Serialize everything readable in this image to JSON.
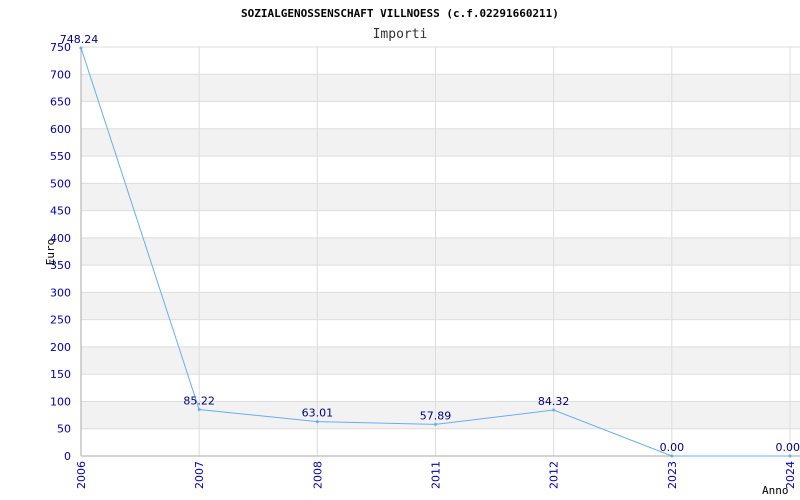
{
  "chart_data": {
    "type": "line",
    "title": "SOZIALGENOSSENSCHAFT VILLNOESS (c.f.02291660211)",
    "subtitle": "Importi",
    "xlabel": "Anno",
    "ylabel": "Euro",
    "categories": [
      "2006",
      "2007",
      "2008",
      "2011",
      "2012",
      "2023",
      "2024"
    ],
    "series": [
      {
        "values": [
          748.24,
          85.22,
          63.01,
          57.89,
          84.32,
          0.0,
          0.0
        ]
      }
    ],
    "data_labels": [
      "748.24",
      "85.22",
      "63.01",
      "57.89",
      "84.32",
      "0.00",
      "0.00"
    ],
    "yticks": [
      0,
      50,
      100,
      150,
      200,
      250,
      300,
      350,
      400,
      450,
      500,
      550,
      600,
      650,
      700,
      750
    ],
    "ylim": [
      0,
      750
    ],
    "grid": true,
    "colors": {
      "line": "#6aaef0",
      "tick_text": "#0000aa",
      "label_text": "#000080",
      "band": "#f2f2f2",
      "grid": "#dddddd"
    }
  }
}
